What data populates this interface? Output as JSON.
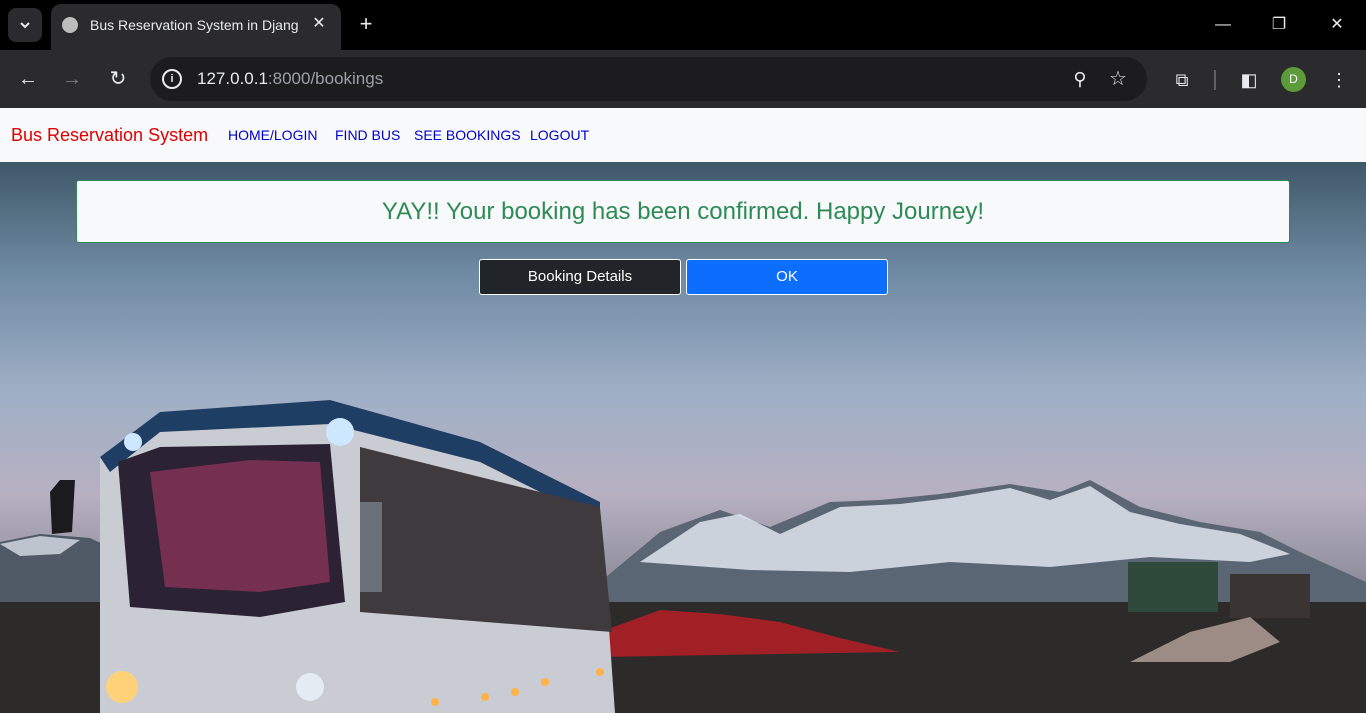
{
  "browser": {
    "tab_title": "Bus Reservation System in Djang",
    "tab_close": "✕",
    "new_tab": "+",
    "url_host": "127.0.0.1",
    "url_rest": ":8000/bookings",
    "profile_initial": "D"
  },
  "navbar": {
    "brand": "Bus Reservation System",
    "links": [
      "HOME/LOGIN",
      "FIND BUS",
      "SEE BOOKINGS",
      "LOGOUT"
    ]
  },
  "alert": {
    "message": "YAY!! Your booking has been confirmed. Happy Journey!"
  },
  "actions": {
    "details_label": "Booking Details",
    "ok_label": "OK"
  },
  "colors": {
    "brand": "#e00000",
    "nav_link": "#0000cc",
    "success": "#2e8b57",
    "primary": "#0d6efd",
    "dark": "#212529"
  }
}
